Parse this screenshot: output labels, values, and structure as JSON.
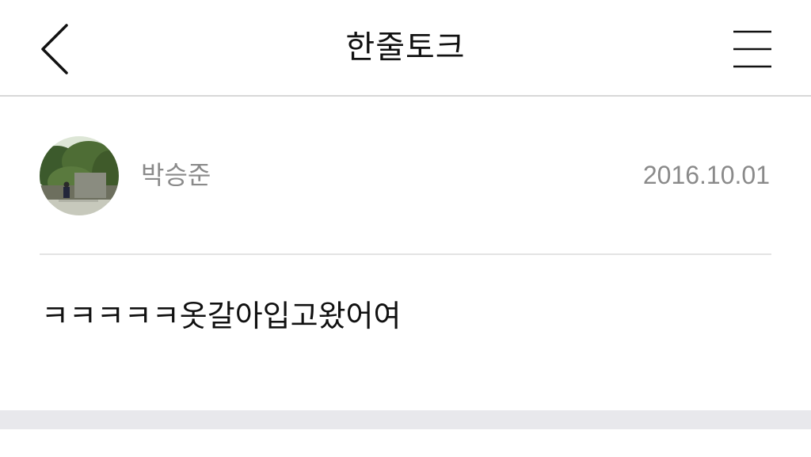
{
  "header": {
    "title": "한줄토크"
  },
  "post": {
    "author": "박승준",
    "date": "2016.10.01",
    "message": "ㅋㅋㅋㅋㅋ옷갈아입고왔어여"
  },
  "icons": {
    "back": "chevron-left-icon",
    "menu": "hamburger-menu-icon"
  },
  "colors": {
    "secondary_text": "#8a8a8a",
    "band": "#e8e8ec"
  }
}
